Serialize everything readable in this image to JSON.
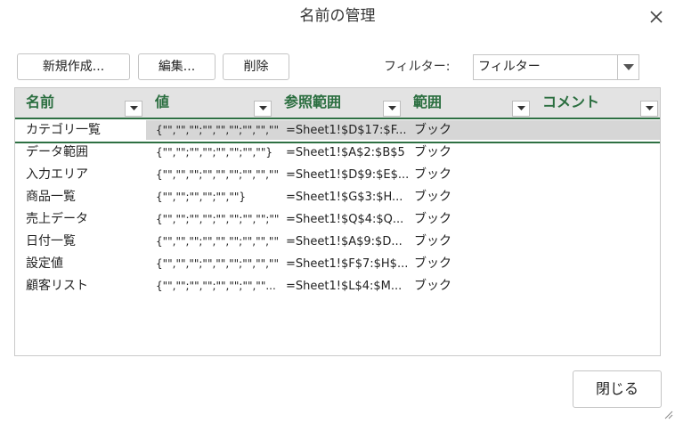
{
  "dialog": {
    "title": "名前の管理",
    "close_icon": "close-icon",
    "close_button_label": "閉じる"
  },
  "toolbar": {
    "new_label": "新規作成...",
    "edit_label": "編集...",
    "delete_label": "削除",
    "filter_label": "フィルター:",
    "filter_value": "フィルター"
  },
  "table": {
    "columns": [
      "名前",
      "値",
      "参照範囲",
      "範囲",
      "コメント"
    ],
    "rows": [
      {
        "name": "カテゴリ一覧",
        "value": "{\"\",\"\",\"\";\"\",\"\",\"\";\"\",\"\",\"\"...",
        "ref": "=Sheet1!$D$17:$F...",
        "scope": "ブック",
        "comment": ""
      },
      {
        "name": "データ範囲",
        "value": "{\"\",\"\";\"\",\"\";\"\",\"\";\"\",\"\"}",
        "ref": "=Sheet1!$A$2:$B$5",
        "scope": "ブック",
        "comment": ""
      },
      {
        "name": "入力エリア",
        "value": "{\"\",\"\",\"\";\"\",\"\",\"\";\"\",\"\",\"\"...",
        "ref": "=Sheet1!$D$9:$E$...",
        "scope": "ブック",
        "comment": ""
      },
      {
        "name": "商品一覧",
        "value": "{\"\",\"\";\"\",\"\";\"\",\"\"}",
        "ref": "=Sheet1!$G$3:$H...",
        "scope": "ブック",
        "comment": ""
      },
      {
        "name": "売上データ",
        "value": "{\"\",\"\";\"\",\"\";\"\",\"\";\"\",\"\";\"\"...",
        "ref": "=Sheet1!$Q$4:$Q...",
        "scope": "ブック",
        "comment": ""
      },
      {
        "name": "日付一覧",
        "value": "{\"\",\"\",\"\";\"\",\"\",\"\";\"\",\"\",\"\"...",
        "ref": "=Sheet1!$A$9:$D...",
        "scope": "ブック",
        "comment": ""
      },
      {
        "name": "設定値",
        "value": "{\"\",\"\",\"\";\"\",\"\",\"\";\"\",\"\",\"\"...",
        "ref": "=Sheet1!$F$7:$H$...",
        "scope": "ブック",
        "comment": ""
      },
      {
        "name": "顧客リスト",
        "value": "{\"\",\"\";\"\",\"\";\"\",\"\";\"\",\"\"...",
        "ref": "=Sheet1!$L$4:$M...",
        "scope": "ブック",
        "comment": ""
      }
    ],
    "selected_row": 0
  },
  "colors": {
    "header_text": "#2a6e3f",
    "accent_line": "#2e7043",
    "header_bg": "#e3e3e3",
    "selection_bg": "#d6d6d6"
  }
}
